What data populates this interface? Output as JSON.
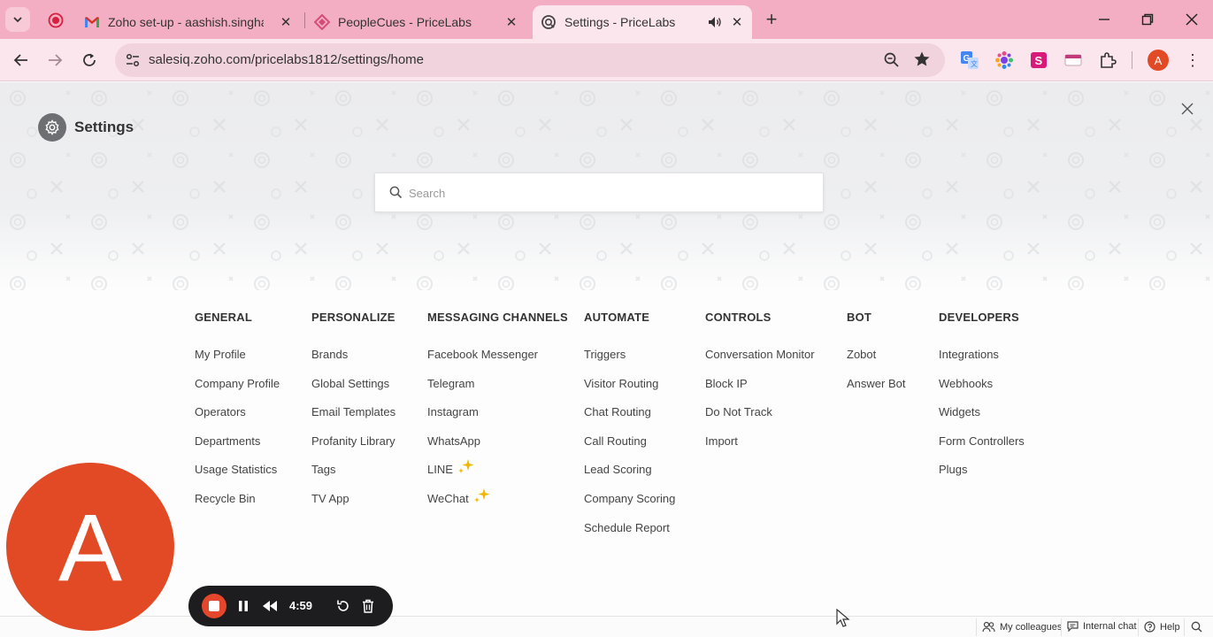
{
  "browser": {
    "tabs": [
      {
        "title": "Zoho set-up - aashish.singhal@",
        "active": false
      },
      {
        "title": "PeopleCues - PriceLabs",
        "active": false
      },
      {
        "title": "Settings - PriceLabs",
        "active": true
      }
    ],
    "url": "salesiq.zoho.com/pricelabs1812/settings/home",
    "profile_initial": "A"
  },
  "page": {
    "title": "Settings",
    "search_placeholder": "Search"
  },
  "columns": [
    {
      "heading": "GENERAL",
      "items": [
        "My Profile",
        "Company Profile",
        "Operators",
        "Departments",
        "Usage Statistics",
        "Recycle Bin"
      ]
    },
    {
      "heading": "PERSONALIZE",
      "items": [
        "Brands",
        "Global Settings",
        "Email Templates",
        "Profanity Library",
        "Tags",
        "TV App"
      ]
    },
    {
      "heading": "MESSAGING CHANNELS",
      "items": [
        "Facebook Messenger",
        "Telegram",
        "Instagram",
        "WhatsApp",
        "LINE",
        "WeChat"
      ]
    },
    {
      "heading": "AUTOMATE",
      "items": [
        "Triggers",
        "Visitor Routing",
        "Chat Routing",
        "Call Routing",
        "Lead Scoring",
        "Company Scoring",
        "Schedule Report"
      ]
    },
    {
      "heading": "CONTROLS",
      "items": [
        "Conversation Monitor",
        "Block IP",
        "Do Not Track",
        "Import"
      ]
    },
    {
      "heading": "BOT",
      "items": [
        "Zobot",
        "Answer Bot"
      ]
    },
    {
      "heading": "DEVELOPERS",
      "items": [
        "Integrations",
        "Webhooks",
        "Widgets",
        "Form Controllers",
        "Plugs"
      ]
    }
  ],
  "avatar": {
    "initial": "A"
  },
  "recorder": {
    "time": "4:59"
  },
  "footer": {
    "my_colleagues": "My colleagues",
    "internal_chat": "Internal chat",
    "help": "Help"
  },
  "colors": {
    "tab_bar": "#f3aec3",
    "toolbar": "#fce6ee",
    "avatar": "#e24a25",
    "recorder": "#1d1d1f"
  }
}
